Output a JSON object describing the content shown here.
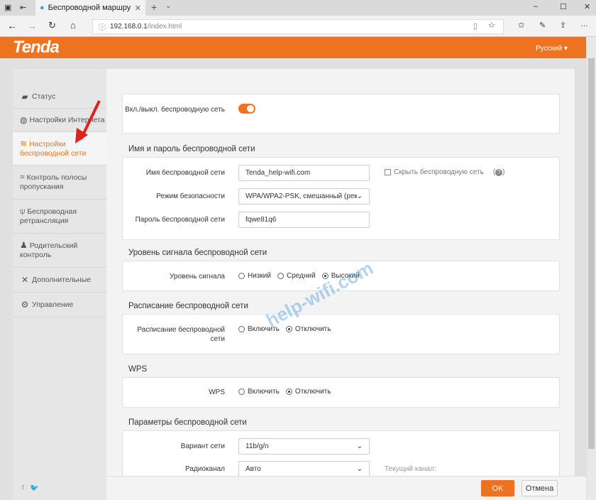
{
  "browser": {
    "tab_title": "Беспроводной маршру",
    "url_host": "192.168.0.1",
    "url_path": "/index.html"
  },
  "header": {
    "logo": "Tenda",
    "language": "Русский"
  },
  "sidebar": {
    "items": [
      {
        "label": "Статус",
        "icon": "router-icon"
      },
      {
        "label": "Настройки Интернета",
        "icon": "globe-icon"
      },
      {
        "label": "Настройки беспроводной сети",
        "icon": "wifi-icon",
        "active": true
      },
      {
        "label": "Контроль полосы пропускания",
        "icon": "bandwidth-icon"
      },
      {
        "label": "Беспроводная ретрансляция",
        "icon": "antenna-icon"
      },
      {
        "label": "Родительский контроль",
        "icon": "parent-icon"
      },
      {
        "label": "Дополнительные",
        "icon": "tools-icon"
      },
      {
        "label": "Управление",
        "icon": "gear-icon"
      }
    ],
    "social": {
      "facebook": "f",
      "twitter": "t"
    }
  },
  "wireless": {
    "toggle_label": "Вкл./выкл. беспроводную сеть",
    "enabled": true
  },
  "ssid_section": {
    "title": "Имя и пароль беспроводной сети",
    "ssid_label": "Имя беспроводной сети",
    "ssid_value": "Tenda_help-wifi.com",
    "hide_label": "Скрыть беспроводную сеть",
    "help": "?",
    "security_label": "Режим безопасности",
    "security_value": "WPA/WPA2-PSK, смешанный (рек",
    "password_label": "Пароль беспроводной сети",
    "password_value": "fqwe81q6"
  },
  "signal_section": {
    "title": "Уровень сигнала беспроводной сети",
    "label": "Уровень сигнала",
    "options": [
      "Низкий",
      "Средний",
      "Высокий"
    ],
    "selected": 2
  },
  "schedule_section": {
    "title": "Расписание беспроводной сети",
    "label": "Расписание беспроводной сети",
    "options": [
      "Включить",
      "Отключить"
    ],
    "selected": 1
  },
  "wps_section": {
    "title": "WPS",
    "label": "WPS",
    "options": [
      "Включить",
      "Отключить"
    ],
    "selected": 1
  },
  "params_section": {
    "title": "Параметры беспроводной сети",
    "mode_label": "Вариант сети",
    "mode_value": "11b/g/n",
    "channel_label": "Радиоканал",
    "channel_value": "Авто",
    "current_channel_label": "Текущий канал:"
  },
  "footer": {
    "ok": "OK",
    "cancel": "Отмена"
  },
  "watermark": "help-wifi.com",
  "colors": {
    "accent": "#ee7320"
  }
}
